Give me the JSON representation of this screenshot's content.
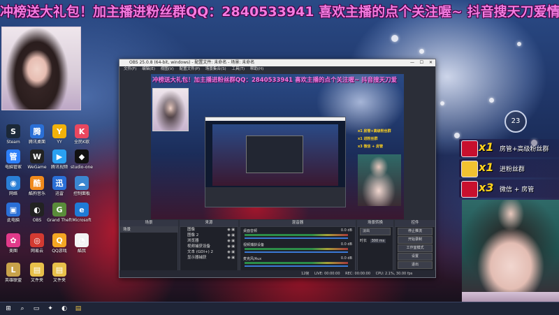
{
  "marquee_text": "冲榜送大礼包！加主播进粉丝群QQ：2840533941 喜欢主播的点个关注喔~ 抖音搜天刀爱情",
  "clock": {
    "value": "23"
  },
  "desktop_icons": [
    {
      "label": "Steam",
      "color": "#1b2838",
      "glyph": "S"
    },
    {
      "label": "腾讯桌面",
      "color": "#2a6fd6",
      "glyph": "腾"
    },
    {
      "label": "YY",
      "color": "#f2b20a",
      "glyph": "Y"
    },
    {
      "label": "全民K歌",
      "color": "#e9475f",
      "glyph": "K"
    },
    {
      "label": "电脑管家",
      "color": "#2d7ff9",
      "glyph": "管"
    },
    {
      "label": "WeGame",
      "color": "#222",
      "glyph": "W"
    },
    {
      "label": "腾讯视频",
      "color": "#2aa1f2",
      "glyph": "▶"
    },
    {
      "label": "studio-one",
      "color": "#111",
      "glyph": "◆"
    },
    {
      "label": "网络",
      "color": "#2a7fd6",
      "glyph": "◉"
    },
    {
      "label": "酷狗音乐",
      "color": "#f08a1c",
      "glyph": "酷"
    },
    {
      "label": "迅雷",
      "color": "#2a6fd6",
      "glyph": "迅"
    },
    {
      "label": "控制面板",
      "color": "#3b86d0",
      "glyph": "☁"
    },
    {
      "label": "此电脑",
      "color": "#2a6fd6",
      "glyph": "▣"
    },
    {
      "label": "OBS",
      "color": "#222",
      "glyph": "◐"
    },
    {
      "label": "Grand Theft",
      "color": "#5a8c3a",
      "glyph": "G"
    },
    {
      "label": "Microsoft",
      "color": "#1f7bd6",
      "glyph": "e"
    },
    {
      "label": "美图",
      "color": "#e23a8a",
      "glyph": "✿"
    },
    {
      "label": "网易云",
      "color": "#d33a31",
      "glyph": "◎"
    },
    {
      "label": "QQ游戏",
      "color": "#f5a623",
      "glyph": "Q"
    },
    {
      "label": "酷我",
      "color": "#f3f3f3",
      "glyph": "◔"
    },
    {
      "label": "英雄联盟",
      "color": "#c8a24a",
      "glyph": "L"
    },
    {
      "label": "文件夹",
      "color": "#e8c04a",
      "glyph": "▤"
    },
    {
      "label": "文件夹",
      "color": "#e8c04a",
      "glyph": "▤"
    }
  ],
  "obs": {
    "title": "OBS 25.0.8 (64-bit, windows) - 配置文件: 未命名 - 场景: 未命名",
    "menu": [
      "文件(F)",
      "编辑(E)",
      "视图(V)",
      "配置文件(P)",
      "场景集合(S)",
      "工具(T)",
      "帮助(H)"
    ],
    "preview_marquee": "冲榜送大礼包！加主播进粉丝群QQ：2840533941 喜欢主播的点个关注喔~ 抖音搜天刀爱",
    "docks": {
      "scenes": {
        "header": "场景",
        "items": [
          "场景"
        ]
      },
      "sources": {
        "header": "来源",
        "items": [
          "图像",
          "图像 2",
          "浏览器",
          "视频捕获设备",
          "文本 (GDI+) 2",
          "显示器捕获"
        ]
      },
      "mixer": {
        "header": "混音器",
        "tracks": [
          {
            "name": "桌面音频",
            "db": "0.0 dB"
          },
          {
            "name": "视频捕获设备",
            "db": "0.0 dB"
          },
          {
            "name": "麦克风/Aux",
            "db": "0.0 dB"
          }
        ]
      },
      "transitions": {
        "header": "场景转换",
        "type": "淡出",
        "duration_label": "时长",
        "duration": "300 ms"
      },
      "controls": {
        "header": "控件",
        "buttons": [
          "停止推流",
          "开始录制",
          "工作室模式",
          "设置",
          "退出"
        ]
      }
    },
    "status": {
      "live": "LIVE: 00:00:00",
      "rec": "REC: 00:00:00",
      "cpu": "CPU: 2.1%, 30.00 fps",
      "frames": "12帧"
    }
  },
  "gifts": [
    {
      "count": "x1",
      "text": "房管+高级粉丝群",
      "color": "#c8102e"
    },
    {
      "count": "x1",
      "text": "进粉丝群",
      "color": "#f2c230"
    },
    {
      "count": "x3",
      "text": "微信 + 房管",
      "color": "#c8102e"
    }
  ],
  "taskbar": {
    "icons": [
      "windows-logo",
      "search",
      "task-view",
      "edge",
      "obs",
      "folder"
    ]
  }
}
